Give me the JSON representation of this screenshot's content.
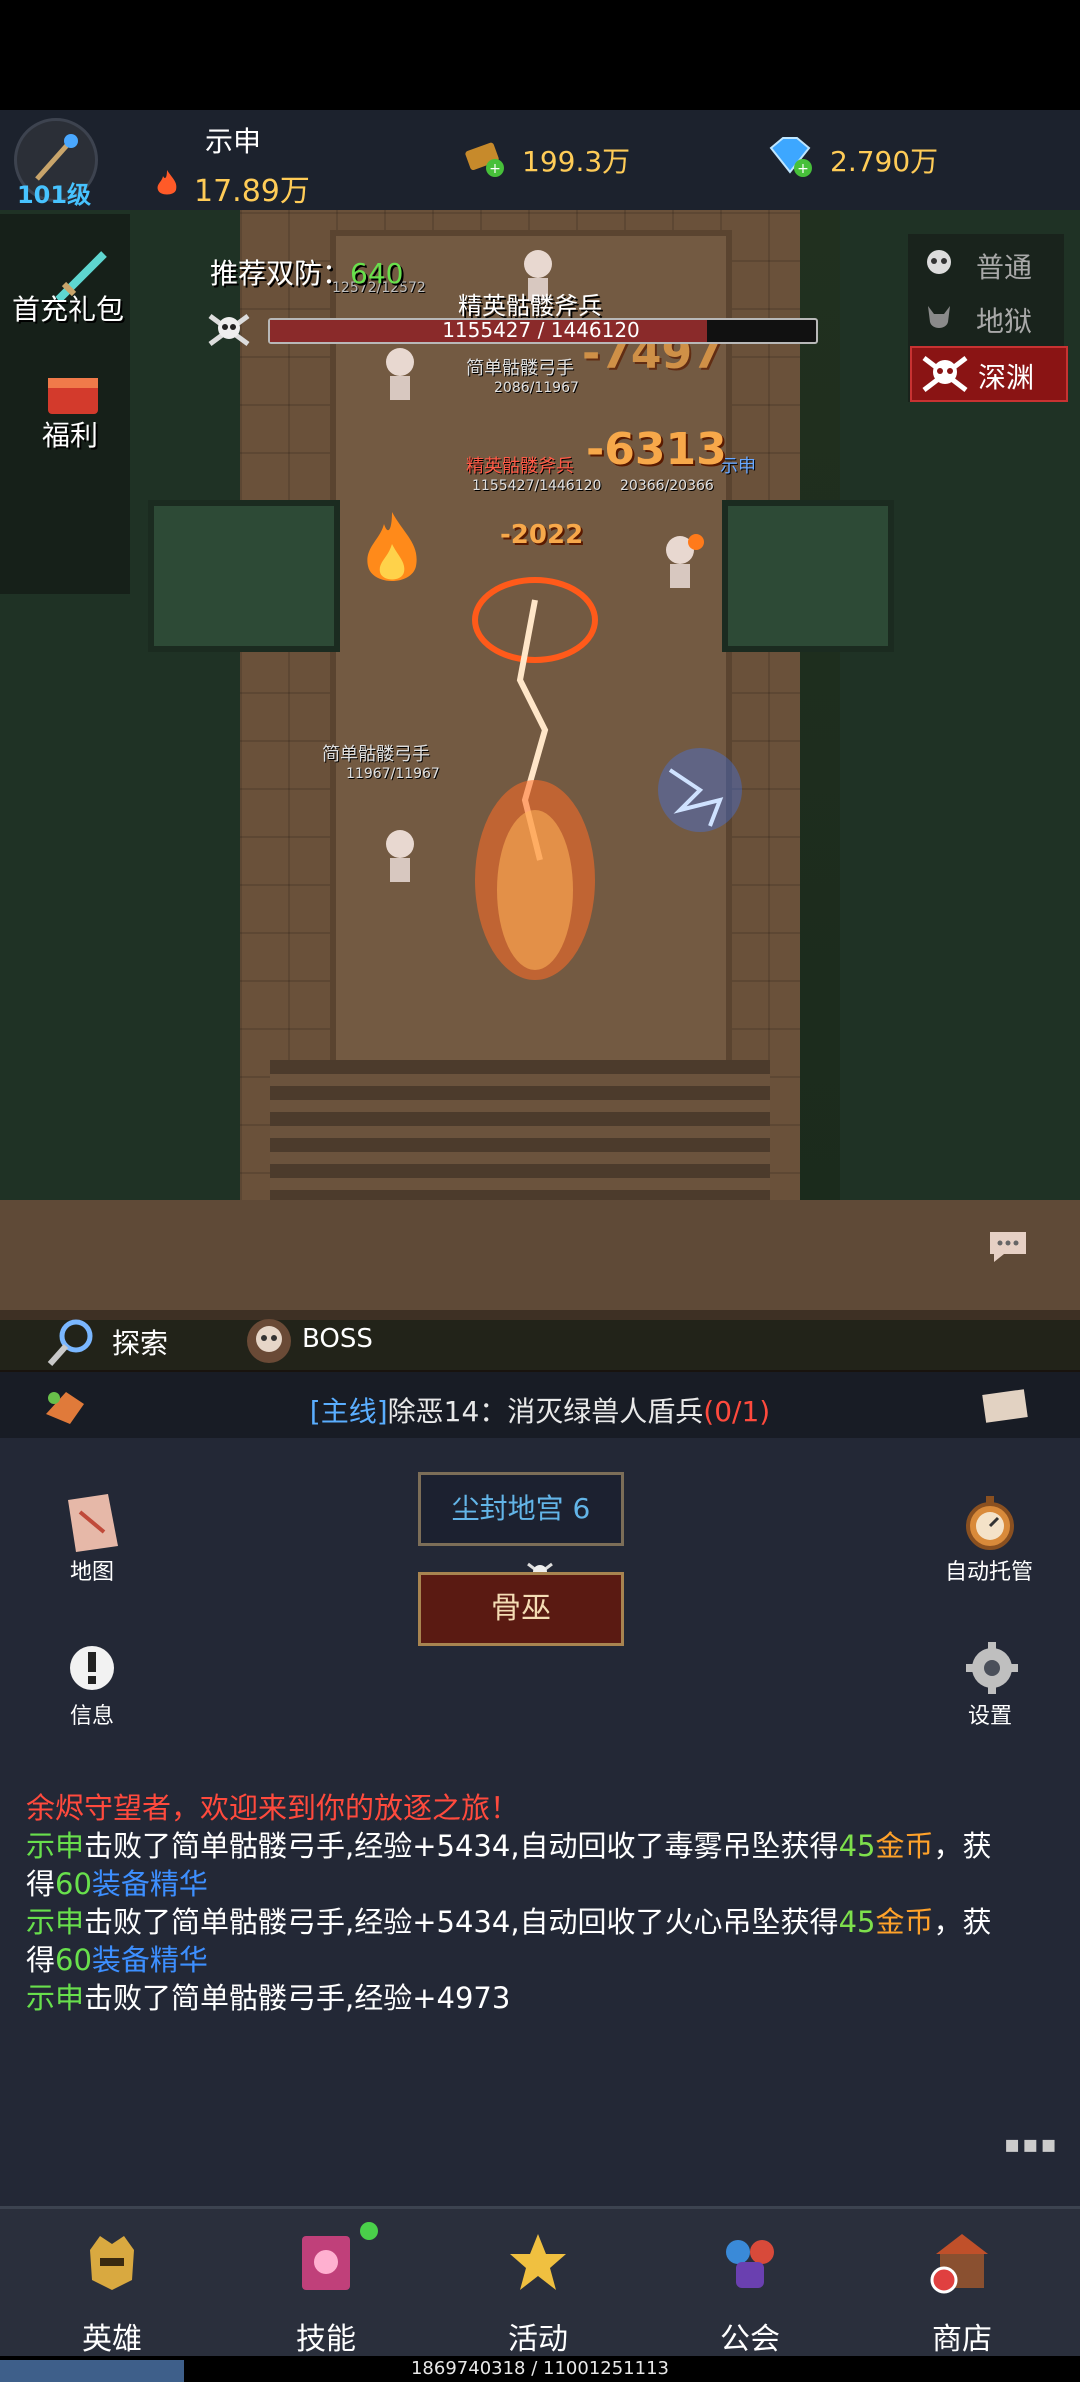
{
  "player": {
    "name": "示申",
    "level": "101级",
    "power": "17.89万"
  },
  "resources": {
    "gold": "199.3万",
    "gems": "2.790万"
  },
  "side_buttons": {
    "first_charge": "首充礼包",
    "welfare": "福利"
  },
  "difficulty": [
    {
      "label": "普通",
      "active": false
    },
    {
      "label": "地狱",
      "active": false
    },
    {
      "label": "深渊",
      "active": true
    }
  ],
  "battle": {
    "recommend_label": "推荐双防：",
    "recommend_value": "640",
    "boss_name": "精英骷髅斧兵",
    "boss_hp": "1155427 / 1446120",
    "boss_hp_fraction": 0.8,
    "enemy1_name": "简单骷髅弓手",
    "enemy1_hp": "2086/11967",
    "enemy2_name": "精英骷髅斧兵",
    "enemy2_hp": "1155427/1446120",
    "player_tag": "示申",
    "player_hp": "20366/20366",
    "enemy3_name": "简单骷髅弓手",
    "enemy3_hp": "11967/11967",
    "damage1": "-6313",
    "damage2": "-2022",
    "damage3": "-7497",
    "enemy0_hp": "12572/12572"
  },
  "explore": {
    "explore_label": "探索",
    "boss_label": "BOSS"
  },
  "quest": {
    "tag": "[主线]",
    "text": "除恶14：消灭绿兽人盾兵",
    "progress": "(0/1)"
  },
  "panel": {
    "map_label": "地图",
    "auto_label": "自动托管",
    "info_label": "信息",
    "settings_label": "设置",
    "location_button": "尘封地宫 6",
    "boss_button": "骨巫"
  },
  "log": {
    "line1": "余烬守望者，欢迎来到你的放逐之旅！",
    "l2_name": "示申",
    "l2_text": "击败了简单骷髅弓手,经验+5434,自动回收了毒雾吊坠获得",
    "l2_gold": "45金币",
    "l2_tail": "，获",
    "l3_head": "得",
    "l3_amount": "60装备精华",
    "l4_name": "示申",
    "l4_text": "击败了简单骷髅弓手,经验+5434,自动回收了火心吊坠获得",
    "l4_gold": "45金币",
    "l4_tail": "，获",
    "l5_head": "得",
    "l5_amount": "60装备精华",
    "l6_name": "示申",
    "l6_text": "击败了简单骷髅弓手,经验+4973"
  },
  "nav": {
    "hero": "英雄",
    "skill": "技能",
    "activity": "活动",
    "guild": "公会",
    "shop": "商店"
  },
  "footer": {
    "exp": "1869740318 / 11001251113",
    "exp_fraction": 0.17
  },
  "colors": {
    "accent_gold": "#ffcc57",
    "accent_blue": "#47c3ff",
    "log_red": "#ff4a3d",
    "log_green": "#68e04c",
    "log_orange": "#ffa22a"
  }
}
